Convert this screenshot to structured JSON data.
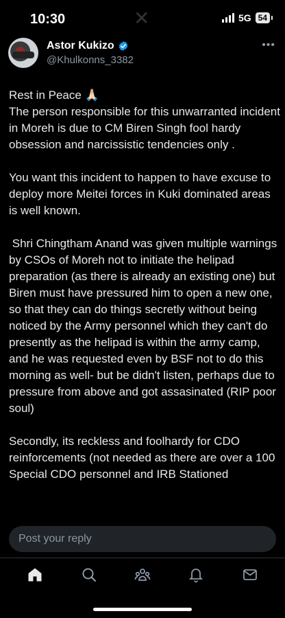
{
  "status_bar": {
    "time": "10:30",
    "network": "5G",
    "battery": "54"
  },
  "post": {
    "author_name": "Astor Kukizo",
    "handle": "@Khulkonns_3382",
    "verified_color": "#1d9bf0",
    "paragraphs": [
      "Rest in Peace 🙏🏻\nThe person responsible for this unwarranted incident in Moreh is due to CM Biren Singh fool hardy obsession and narcissistic tendencies only .",
      "You want this incident to happen to have excuse to deploy more Meitei forces in Kuki dominated areas is well known.",
      " Shri Chingtham Anand was given multiple warnings by CSOs of Moreh not to initiate the helipad preparation (as there is already an existing one) but Biren must have pressured him to open a new one, so that they can do things secretly without being noticed by the Army personnel which they can't do presently as the helipad is within the army camp, and he was requested even by BSF not to do this morning as well- but be didn't listen, perhaps due to pressure from above and got assasinated (RIP poor soul)",
      "Secondly, its reckless and foolhardy for CDO reinforcements (not needed as there are over a 100 Special CDO personnel and IRB Stationed"
    ]
  },
  "reply": {
    "placeholder": "Post your reply"
  },
  "tabs": [
    {
      "name": "home-icon"
    },
    {
      "name": "search-icon"
    },
    {
      "name": "communities-icon"
    },
    {
      "name": "notifications-icon"
    },
    {
      "name": "messages-icon"
    }
  ],
  "colors": {
    "background": "#000000",
    "text": "#e7e9ea",
    "secondary": "#8b98a5",
    "accent": "#1d9bf0"
  }
}
